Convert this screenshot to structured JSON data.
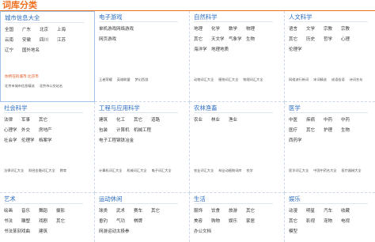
{
  "page": {
    "title": "词库分类"
  },
  "categories": [
    {
      "title": "城市信息大全",
      "highlight": true,
      "rows": [
        [
          "全国",
          "广东",
          "北京",
          "上海"
        ],
        [
          "云南",
          "安徽",
          "四川",
          "江苏"
        ],
        [
          "辽宁",
          "国外地名"
        ]
      ],
      "callout": "你所在的城市:北京市",
      "sub": [
        "北京市城市信息精选",
        "北京市公交站名"
      ]
    },
    {
      "title": "电子游戏",
      "rows": [
        [
          "单机游戏",
          "网络游戏"
        ],
        [
          "网页游戏"
        ]
      ],
      "sub": [
        "王者荣耀",
        "英雄联盟",
        "梦幻西游"
      ]
    },
    {
      "title": "自然科学",
      "rows": [
        [
          "地理",
          "化学",
          "数学",
          "物理"
        ],
        [
          "其它",
          "天文学",
          "气象学",
          "生物"
        ],
        [
          "海洋学",
          "地理地质"
        ]
      ],
      "sub": [
        "动物词汇大全",
        "植物词汇大全",
        "物理词汇大全"
      ]
    },
    {
      "title": "人文科学",
      "rows": [
        [
          "语言",
          "文学",
          "宗教",
          "宗教"
        ],
        [
          "其它",
          "历史",
          "哲学",
          "心理"
        ],
        [
          "伦理学"
        ]
      ],
      "sub": [
        "网络流行新词",
        "宋词精选",
        "成语俗语",
        "诗词名句"
      ]
    },
    {
      "title": "社会科学",
      "rows": [
        [
          "法律",
          "军事",
          "其它"
        ],
        [
          "心理学",
          "外交",
          "房地产"
        ],
        [
          "社会学",
          "伦理学",
          "档案学"
        ]
      ],
      "sub": [
        "法律词汇大全",
        "财经金融词汇大全",
        "教育"
      ]
    },
    {
      "title": "工程与应用科学",
      "rows": [
        [
          "建筑",
          "化工",
          "其它",
          "道路"
        ],
        [
          "包装",
          "计算机",
          "机械工程"
        ],
        [
          "电子工程",
          "钢铁冶金"
        ]
      ],
      "sub": [
        "计算机词汇大全",
        "机械词汇大全",
        "电子词汇大全"
      ]
    },
    {
      "title": "农林渔畜",
      "rows": [
        [
          "农业",
          "林业",
          "渔业"
        ]
      ],
      "sub": [
        "农业词汇大全",
        "林业动植物词库",
        "农学"
      ]
    },
    {
      "title": "医学",
      "rows": [
        [
          "中医",
          "疾病",
          "中药",
          "中药"
        ],
        [
          "医疗",
          "其它",
          "护理",
          "生物"
        ],
        [
          "西药学"
        ]
      ],
      "sub": [
        "医学词汇大全",
        "中国中药名大全",
        "医疗器械大全"
      ]
    },
    {
      "title": "艺术",
      "rows": [
        [
          "绘画",
          "音乐",
          "舞蹈",
          "摄影"
        ],
        [
          "书法",
          "雕塑",
          "戏剧",
          "其它"
        ],
        [
          "书法篆刻",
          "戏曲",
          "建筑"
        ]
      ],
      "sub": []
    },
    {
      "title": "运动休闲",
      "rows": [
        [
          "球类",
          "武术",
          "赛车",
          "其它"
        ],
        [
          "垂钓",
          "气功",
          "棋牌"
        ],
        [
          "网游运动",
          "太极拳"
        ]
      ],
      "sub": []
    },
    {
      "title": "生活",
      "rows": [
        [
          "服饰",
          "饮食",
          "旅游",
          "其它"
        ],
        [
          "美容",
          "购物",
          "娱乐",
          "家居"
        ],
        [
          "办公文档"
        ]
      ],
      "sub": []
    },
    {
      "title": "娱乐",
      "rows": [
        [
          "动漫",
          "明星",
          "汽车",
          "收藏"
        ],
        [
          "其它",
          "影视",
          "宠物",
          "电视"
        ],
        [
          "模型"
        ]
      ],
      "sub": []
    }
  ]
}
